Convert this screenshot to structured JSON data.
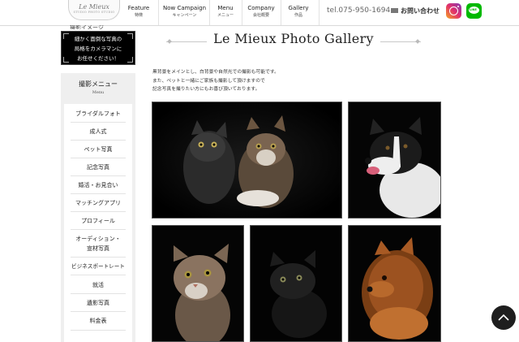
{
  "header": {
    "logo_script": "Le Mieux",
    "logo_sub": "STUDIO PHOTO STUDIO",
    "nav": [
      {
        "en": "Feature",
        "ja": "特徴"
      },
      {
        "en": "Now Campaign",
        "ja": "キャンペーン"
      },
      {
        "en": "Menu",
        "ja": "メニュー"
      },
      {
        "en": "Company",
        "ja": "会社概要"
      },
      {
        "en": "Gallery",
        "ja": "作品"
      }
    ],
    "tel": "tel.075-950-1694",
    "contact": "お問い合わせ",
    "line_label": "LINE"
  },
  "sidebar": {
    "cutoff_text": "撮影イメージ",
    "promo_lines": [
      "細かく面倒な写真の",
      "局格をカメラマンに",
      "お任せください！"
    ],
    "menu_title": "撮影メニュー",
    "menu_sub": "Menu",
    "menu_items": [
      "ブライダルフォト",
      "成人式",
      "ペット写真",
      "記念写真",
      "婚活・お見合い",
      "マッチングアプリ",
      "プロフィール",
      "オーディション・",
      "宣材写真",
      "ビジネスポートレート",
      "就活",
      "遺影写真",
      "料金表"
    ]
  },
  "main": {
    "title": "Le Mieux Photo Gallery",
    "intro": [
      "黒背景をメインとし、白背景や自然光での撮影も可能です。",
      "また、ペットと一緒にご家族も撮影して頂けますので",
      "記念写真を撮りたい方にもお喜び頂いております。"
    ],
    "photos": [
      {
        "subject": "two-cats"
      },
      {
        "subject": "border-collie"
      },
      {
        "subject": "tabby-cat"
      },
      {
        "subject": "black-cat"
      },
      {
        "subject": "pomeranian"
      }
    ]
  },
  "colors": {
    "accent_dark": "#1e1e1e",
    "instagram": "#e1306c",
    "line_green": "#00b900"
  }
}
